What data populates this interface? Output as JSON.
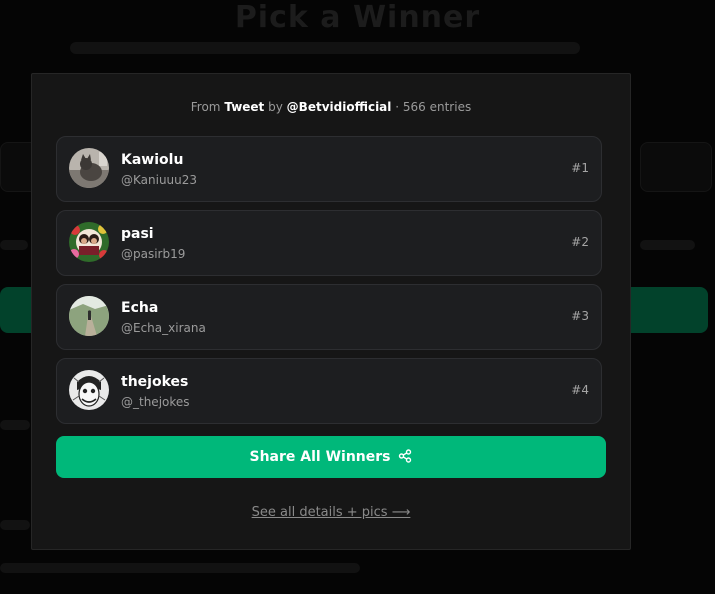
{
  "background": {
    "title": "Pick a Winner"
  },
  "modal": {
    "source": {
      "prefix": "From",
      "platform": "Tweet",
      "by": "by",
      "account": "@Betvidiofficial",
      "separator": "·",
      "entries": "566 entries"
    },
    "winners": [
      {
        "name": "Kawiolu",
        "handle": "@Kaniuuu23",
        "rank": "#1",
        "avatar_icon": "cat-photo"
      },
      {
        "name": "pasi",
        "handle": "@pasirb19",
        "rank": "#2",
        "avatar_icon": "couple-floral-photo"
      },
      {
        "name": "Echa",
        "handle": "@Echa_xirana",
        "rank": "#3",
        "avatar_icon": "landscape-photo"
      },
      {
        "name": "thejokes",
        "handle": "@_thejokes",
        "rank": "#4",
        "avatar_icon": "joker-sketch"
      }
    ],
    "share_label": "Share All Winners",
    "share_icon": "share-icon",
    "details_link": "See all details + pics ⟶"
  },
  "colors": {
    "accent": "#00b87a",
    "modal_bg": "#161616",
    "card_bg": "#1d1e20"
  }
}
